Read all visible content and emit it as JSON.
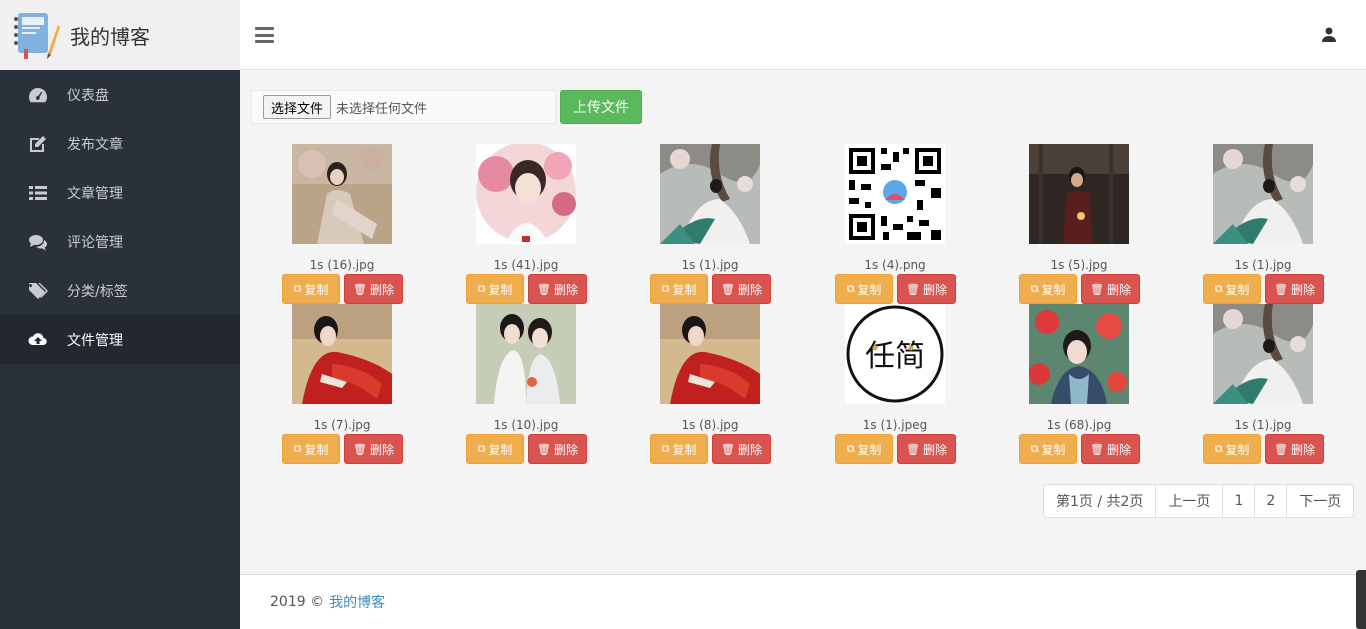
{
  "brand": {
    "title": "我的博客"
  },
  "sidebar": {
    "items": [
      {
        "label": "仪表盘",
        "icon": "dashboard-icon",
        "active": false
      },
      {
        "label": "发布文章",
        "icon": "edit-icon",
        "active": false
      },
      {
        "label": "文章管理",
        "icon": "list-icon",
        "active": false
      },
      {
        "label": "评论管理",
        "icon": "comments-icon",
        "active": false
      },
      {
        "label": "分类/标签",
        "icon": "tags-icon",
        "active": false
      },
      {
        "label": "文件管理",
        "icon": "cloud-upload-icon",
        "active": true
      }
    ]
  },
  "upload": {
    "choose_label": "选择文件",
    "no_file_text": "未选择任何文件",
    "upload_label": "上传文件"
  },
  "files": [
    {
      "name": "1s (16).jpg",
      "thumb": "portrait-blossom"
    },
    {
      "name": "1s (41).jpg",
      "thumb": "portrait-round"
    },
    {
      "name": "1s (1).jpg",
      "thumb": "portrait-tree"
    },
    {
      "name": "1s (4).png",
      "thumb": "qr-code"
    },
    {
      "name": "1s (5).jpg",
      "thumb": "portrait-dark"
    },
    {
      "name": "1s (1).jpg",
      "thumb": "portrait-tree"
    },
    {
      "name": "1s (7).jpg",
      "thumb": "portrait-red"
    },
    {
      "name": "1s (10).jpg",
      "thumb": "portrait-two"
    },
    {
      "name": "1s (8).jpg",
      "thumb": "portrait-red"
    },
    {
      "name": "1s (1).jpeg",
      "thumb": "logo-circle"
    },
    {
      "name": "1s (68).jpg",
      "thumb": "portrait-flowers"
    },
    {
      "name": "1s (1).jpg",
      "thumb": "portrait-tree"
    }
  ],
  "actions": {
    "copy_label": "复制",
    "delete_label": "删除"
  },
  "pagination": {
    "info": "第1页 / 共2页",
    "prev_label": "上一页",
    "pages": [
      "1",
      "2"
    ],
    "next_label": "下一页"
  },
  "footer": {
    "year_text": "2019 ©",
    "link_text": "我的博客"
  },
  "logo_text": "任简",
  "colors": {
    "sidebar_bg": "#2b313b",
    "sidebar_active_bg": "#232830",
    "upload_green": "#5cb85c",
    "copy_orange": "#f0ad4e",
    "delete_red": "#d9534f",
    "link_blue": "#3c8dbc"
  }
}
